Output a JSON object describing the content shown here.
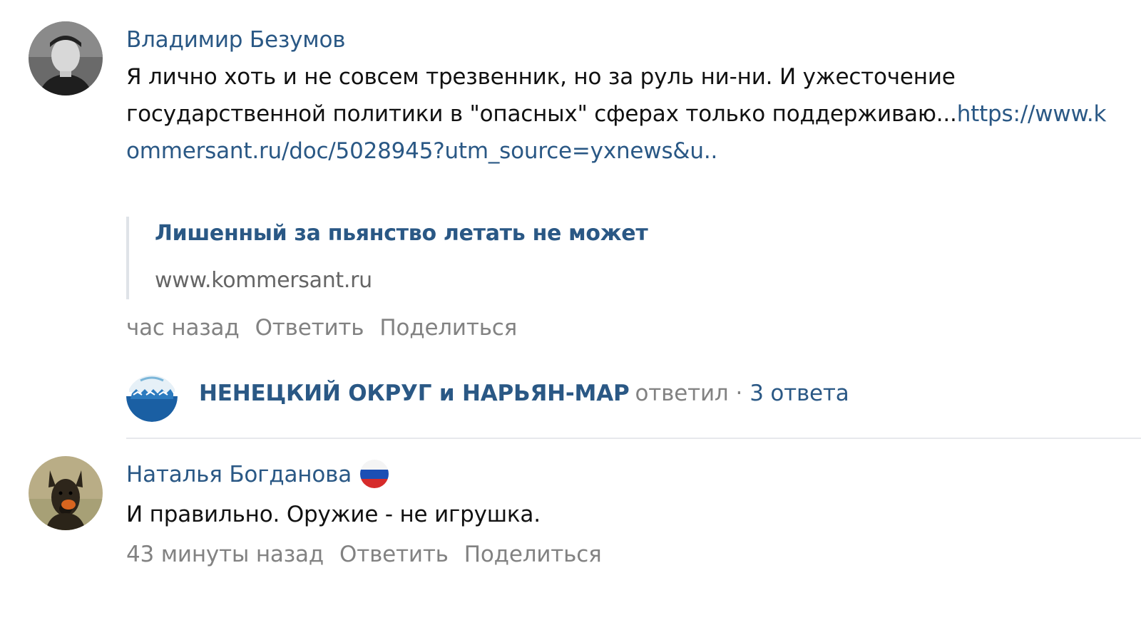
{
  "comments": [
    {
      "author": "Владимир Безумов",
      "text_plain": "Я лично хоть и не совсем трезвенник, но за руль ни-ни. И ужесточение государственной политики в \"опасных\" сферах только поддерживаю...",
      "text_link": "https://www.kommersant.ru/doc/5028945?utm_source=yxnews&u..",
      "snippet": {
        "title": "Лишенный за пьянство летать не может",
        "domain": "www.kommersant.ru"
      },
      "time": "час назад",
      "reply_label": "Ответить",
      "share_label": "Поделиться",
      "thread": {
        "name": "НЕНЕЦКИЙ ОКРУГ и НАРЬЯН-МАР",
        "replied": "ответил",
        "dot": "·",
        "count": "3 ответа"
      }
    },
    {
      "author": "Наталья Богданова",
      "flag_icon": "russia-flag-icon",
      "text_plain": "И правильно. Оружие - не игрушка.",
      "time": "43 минуты назад",
      "reply_label": "Ответить",
      "share_label": "Поделиться"
    }
  ],
  "colors": {
    "link": "#2a5885",
    "meta": "#828282",
    "text": "#111111",
    "divider": "#e7e8ec"
  }
}
